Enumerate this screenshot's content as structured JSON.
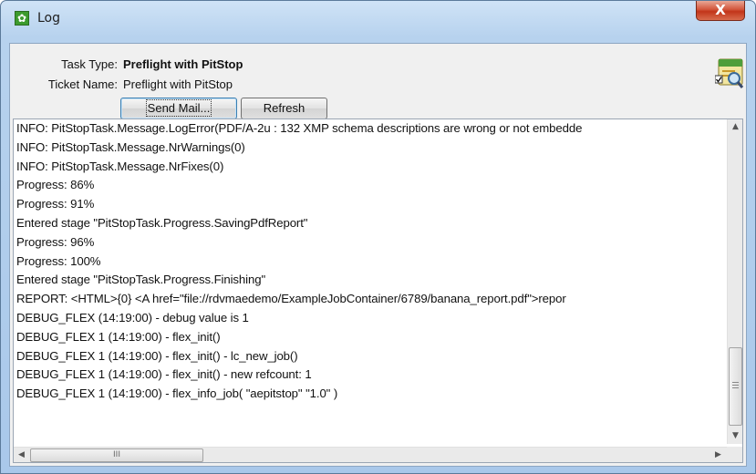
{
  "window": {
    "title": "Log",
    "close_label": "X"
  },
  "header": {
    "task_type_label": "Task Type:",
    "task_type_value": "Preflight with PitStop",
    "ticket_name_label": "Ticket Name:",
    "ticket_name_value": "Preflight with PitStop"
  },
  "buttons": {
    "send_mail": "Send Mail...",
    "refresh": "Refresh"
  },
  "log": {
    "lines": [
      "INFO: PitStopTask.Message.LogError(PDF/A-2u : 132 XMP schema descriptions are wrong or not embedde",
      "INFO: PitStopTask.Message.NrWarnings(0)",
      "INFO: PitStopTask.Message.NrFixes(0)",
      "Progress: 86%",
      "Progress: 91%",
      "Entered stage \"PitStopTask.Progress.SavingPdfReport\"",
      "Progress: 96%",
      "Progress: 100%",
      "Entered stage \"PitStopTask.Progress.Finishing\"",
      "REPORT: <HTML>{0} <A href=\"file://rdvmaedemo/ExampleJobContainer/6789/banana_report.pdf\">repor",
      "DEBUG_FLEX   (14:19:00) - debug value is 1",
      "DEBUG_FLEX 1 (14:19:00) - flex_init()",
      "DEBUG_FLEX 1 (14:19:00) - flex_init() - lc_new_job()",
      "DEBUG_FLEX 1 (14:19:00) - flex_init() - new refcount: 1",
      "DEBUG_FLEX 1 (14:19:00) - flex_info_job( \"aepitstop\" \"1.0\" )"
    ]
  },
  "scrollbar": {
    "thumb_grip": "III"
  }
}
